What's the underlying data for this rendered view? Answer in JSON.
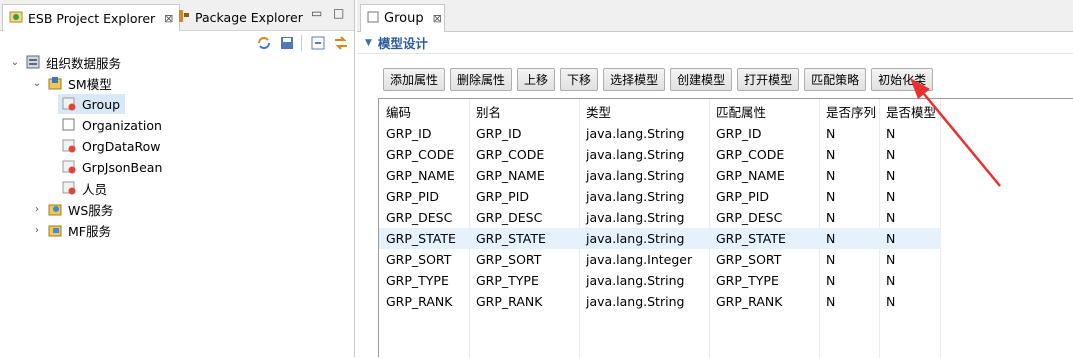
{
  "left_panel": {
    "tabs": [
      {
        "label": "ESB Project Explorer",
        "close": "⊠"
      },
      {
        "label": "Package Explorer"
      }
    ],
    "tree": [
      {
        "label": "组织数据服务",
        "level": 0,
        "expanded": true,
        "icon": "database-icon"
      },
      {
        "label": "SM模型",
        "level": 1,
        "expanded": true,
        "icon": "model-folder-icon"
      },
      {
        "label": "Group",
        "level": 2,
        "icon": "entity-red-icon",
        "selected": true
      },
      {
        "label": "Organization",
        "level": 2,
        "icon": "entity-empty-icon"
      },
      {
        "label": "OrgDataRow",
        "level": 2,
        "icon": "entity-red-icon"
      },
      {
        "label": "GrpJsonBean",
        "level": 2,
        "icon": "entity-red-icon"
      },
      {
        "label": "人员",
        "level": 2,
        "icon": "entity-red-icon"
      },
      {
        "label": "WS服务",
        "level": 1,
        "expanded": false,
        "icon": "ws-service-icon"
      },
      {
        "label": "MF服务",
        "level": 1,
        "expanded": false,
        "icon": "mf-service-icon"
      }
    ]
  },
  "editor": {
    "tab": {
      "label": "Group",
      "close": "⊠"
    },
    "section_title": "模型设计",
    "buttons": [
      "添加属性",
      "删除属性",
      "上移",
      "下移",
      "选择模型",
      "创建模型",
      "打开模型",
      "匹配策略",
      "初始化类"
    ],
    "columns": [
      "编码",
      "别名",
      "类型",
      "匹配属性",
      "是否序列",
      "是否模型"
    ],
    "rows": [
      [
        "GRP_ID",
        "GRP_ID",
        "java.lang.String",
        "GRP_ID",
        "N",
        "N"
      ],
      [
        "GRP_CODE",
        "GRP_CODE",
        "java.lang.String",
        "GRP_CODE",
        "N",
        "N"
      ],
      [
        "GRP_NAME",
        "GRP_NAME",
        "java.lang.String",
        "GRP_NAME",
        "N",
        "N"
      ],
      [
        "GRP_PID",
        "GRP_PID",
        "java.lang.String",
        "GRP_PID",
        "N",
        "N"
      ],
      [
        "GRP_DESC",
        "GRP_DESC",
        "java.lang.String",
        "GRP_DESC",
        "N",
        "N"
      ],
      [
        "GRP_STATE",
        "GRP_STATE",
        "java.lang.String",
        "GRP_STATE",
        "N",
        "N"
      ],
      [
        "GRP_SORT",
        "GRP_SORT",
        "java.lang.Integer",
        "GRP_SORT",
        "N",
        "N"
      ],
      [
        "GRP_TYPE",
        "GRP_TYPE",
        "java.lang.String",
        "GRP_TYPE",
        "N",
        "N"
      ],
      [
        "GRP_RANK",
        "GRP_RANK",
        "java.lang.String",
        "GRP_RANK",
        "N",
        "N"
      ]
    ],
    "selected_row": 5
  },
  "colors": {
    "accent": "#2b5a9a",
    "arrow": "#e8312f",
    "selection": "#e5f1fb"
  }
}
